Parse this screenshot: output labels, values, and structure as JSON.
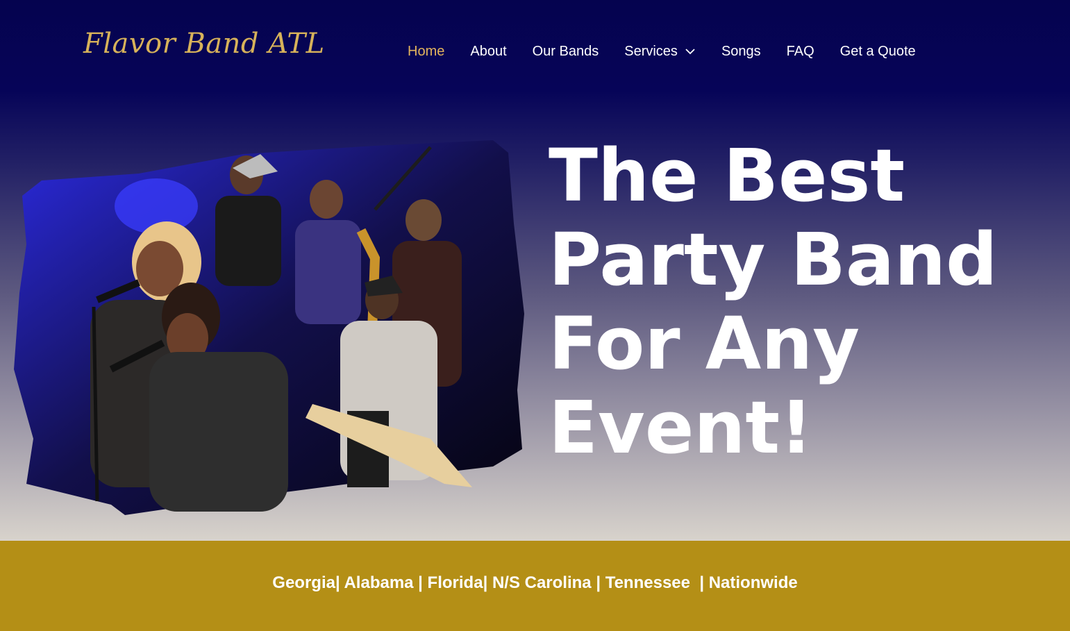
{
  "brand": {
    "logo_text": "Flavor Band ATL",
    "logo_color": "#d7b25a"
  },
  "nav": {
    "items": [
      {
        "label": "Home",
        "active": true
      },
      {
        "label": "About"
      },
      {
        "label": "Our Bands"
      },
      {
        "label": "Services",
        "has_dropdown": true
      },
      {
        "label": "Songs"
      },
      {
        "label": "FAQ"
      },
      {
        "label": "Get a Quote"
      }
    ],
    "active_color": "#e3b45d"
  },
  "hero": {
    "headline": "The Best Party Band For Any Event!",
    "image_icon": "band-performance-photo",
    "gradient_top": "#05034f",
    "gradient_bottom": "#d8d3cc"
  },
  "regions": {
    "text": "Georgia| Alabama | Florida| N/S Carolina | Tennessee  | Nationwide",
    "background": "#b48f16"
  }
}
